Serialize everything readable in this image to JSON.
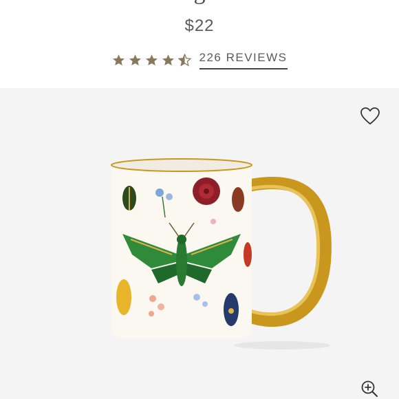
{
  "product": {
    "title_fragment": "g",
    "price": "$22",
    "rating": 4.5,
    "rating_max": 5,
    "reviews_label": "226 REVIEWS"
  },
  "icons": {
    "star": "star-icon",
    "wishlist": "heart-icon",
    "zoom": "zoom-in-icon"
  },
  "colors": {
    "star": "#8a7a5c",
    "panel_bg": "#f4f4f4",
    "gold": "#c9961e"
  }
}
